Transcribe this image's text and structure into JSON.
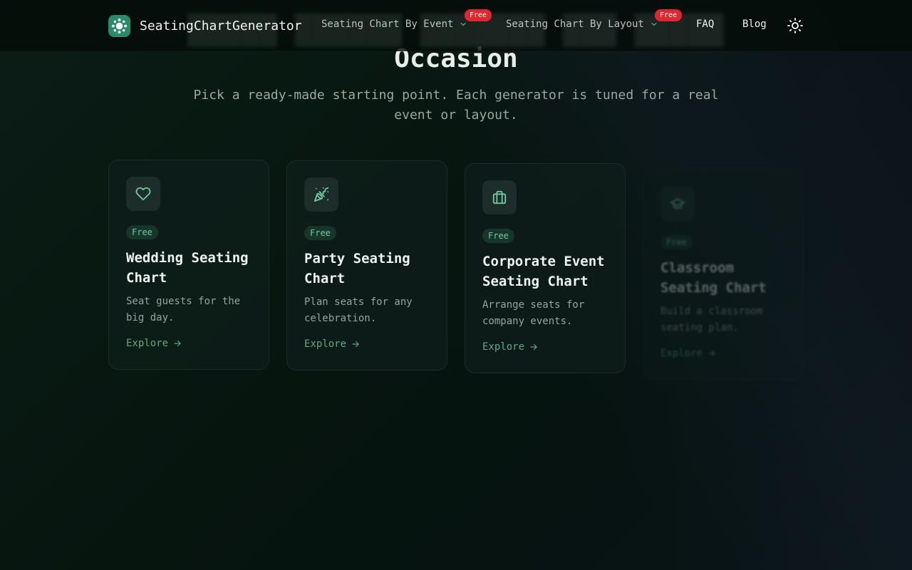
{
  "brand": {
    "name": "SeatingChartGenerator",
    "logo_icon": "table-seats-icon"
  },
  "nav": {
    "items": [
      {
        "label": "Seating Chart By Event",
        "badge": "Free",
        "has_dropdown": true
      },
      {
        "label": "Seating Chart By Layout",
        "badge": "Free",
        "has_dropdown": true
      },
      {
        "label": "FAQ"
      },
      {
        "label": "Blog"
      }
    ],
    "theme_toggle_icon": "sun-icon"
  },
  "hero": {
    "title_partial": "Occasion",
    "subtitle": "Pick a ready-made starting point. Each generator is tuned for a real event or layout."
  },
  "cards": [
    {
      "icon": "heart-icon",
      "badge": "Free",
      "title": "Wedding Seating Chart",
      "description": "Seat guests for the big day.",
      "link": "Explore"
    },
    {
      "icon": "party-popper-icon",
      "badge": "Free",
      "title": "Party Seating Chart",
      "description": "Plan seats for any celebration.",
      "link": "Explore"
    },
    {
      "icon": "briefcase-icon",
      "badge": "Free",
      "title": "Corporate Event Seating Chart",
      "description": "Arrange seats for company events.",
      "link": "Explore"
    },
    {
      "icon": "graduation-cap-icon",
      "badge": "Free",
      "title": "Classroom Seating Chart",
      "description": "Build a classroom seating plan.",
      "link": "Explore"
    }
  ],
  "colors": {
    "accent": "#5fa886",
    "badge_red": "#e0262e",
    "background": "#07140f"
  }
}
